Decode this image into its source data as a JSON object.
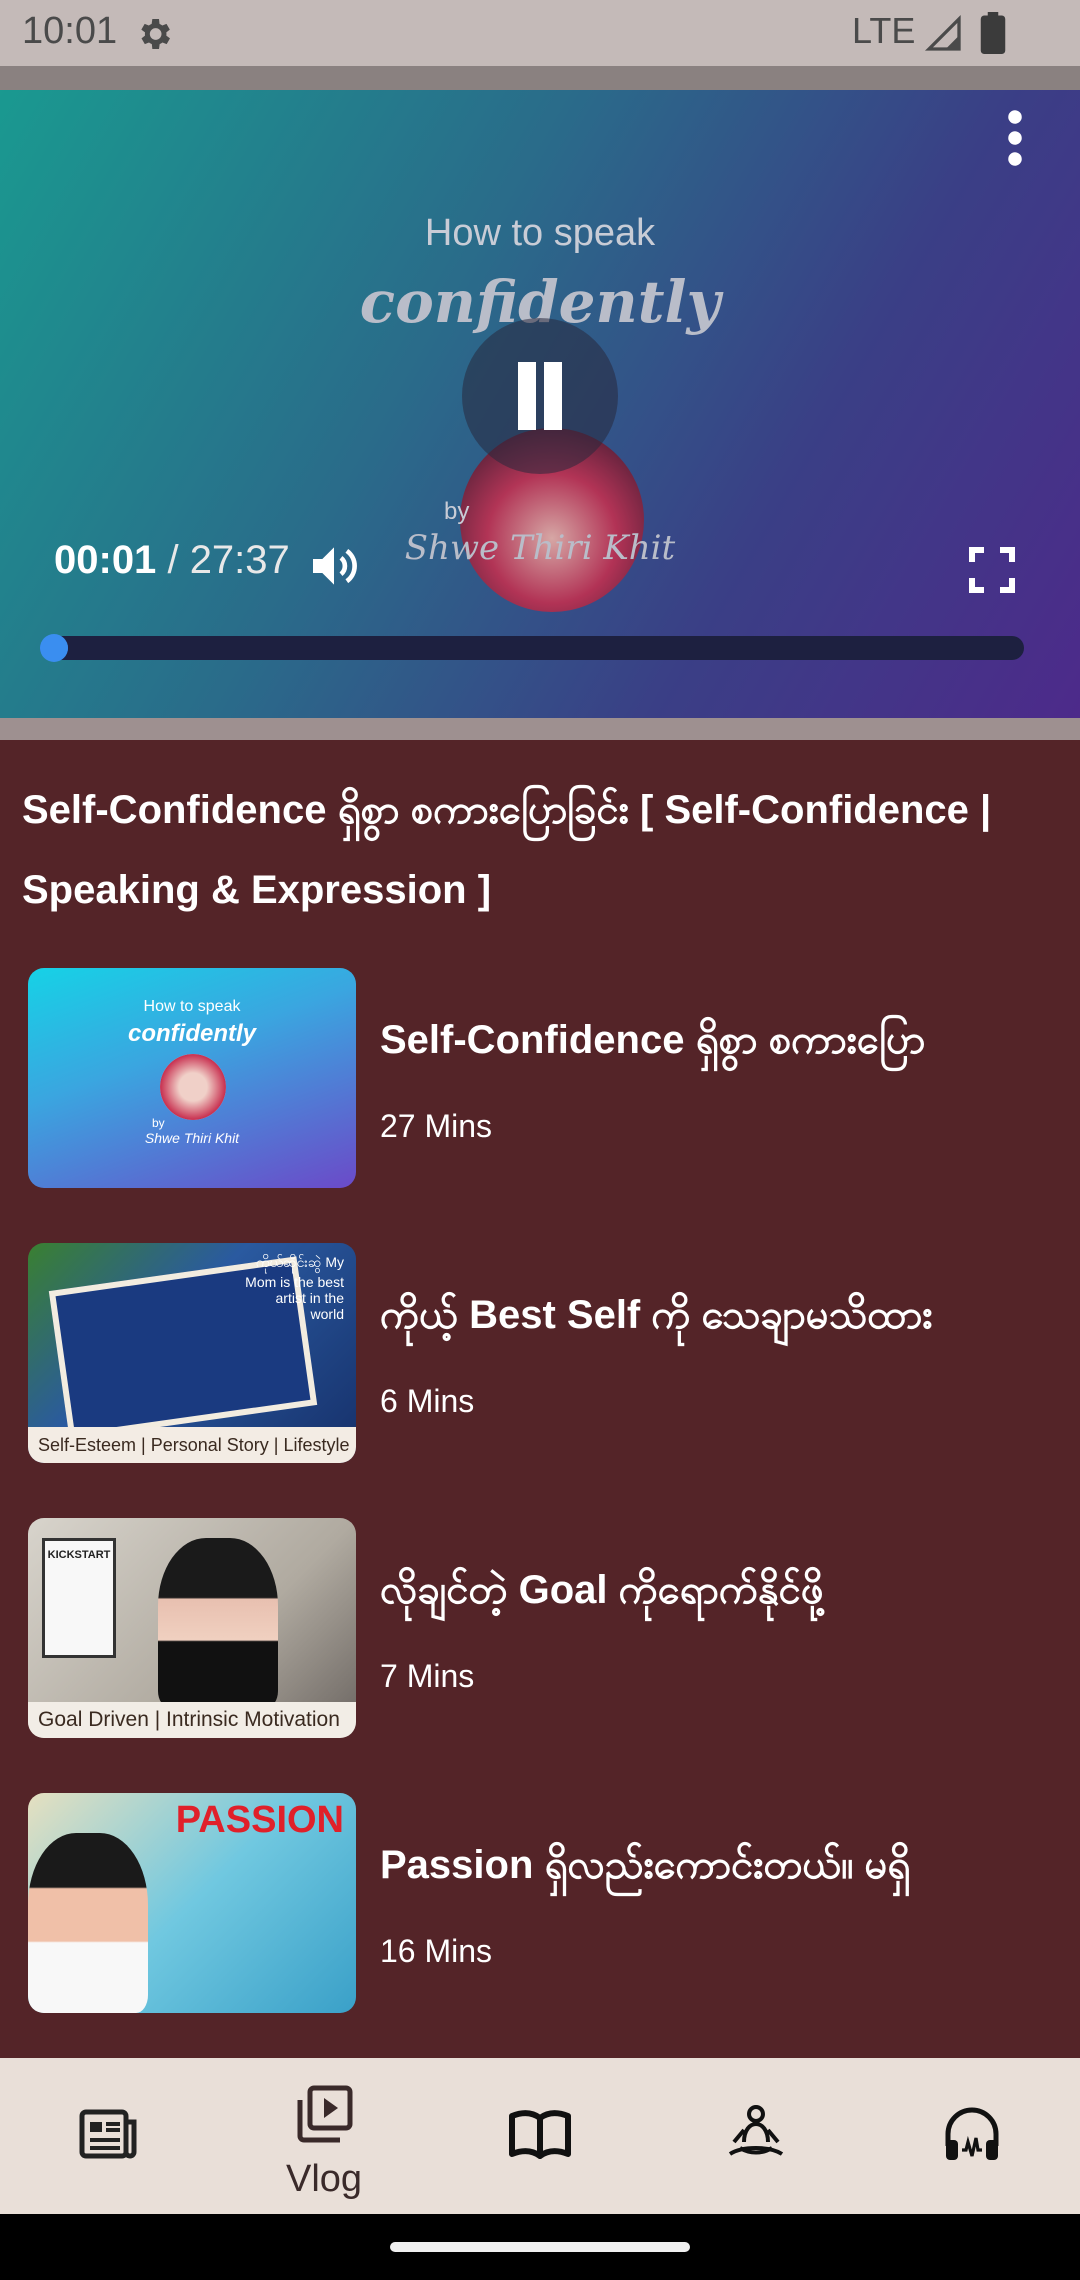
{
  "status_bar": {
    "time": "10:01",
    "network": "LTE"
  },
  "player": {
    "thumbnail": {
      "line1": "How to speak",
      "line2": "confidently",
      "by": "by",
      "author": "Shwe Thiri Khit"
    },
    "current_time": "00:01",
    "separator": "/",
    "duration": "27:37",
    "progress_fraction": 0.01
  },
  "section_title": "Self-Confidence ရှိစွာ စကားပြောခြင်း [ Self-Confidence | Speaking & Expression ]",
  "videos": [
    {
      "title": "Self-Confidence ရှိစွာ စကားပြော",
      "duration": "27 Mins",
      "thumb_line1": "How to speak",
      "thumb_line2": "confidently",
      "thumb_by": "by",
      "thumb_author": "Shwe Thiri Khit"
    },
    {
      "title": "ကိုယ့် Best Self ကို သေချာမသိထား",
      "duration": "6 Mins",
      "thumb_text": "ကိုယ်ဆိုင်းဆွဲ My Mom is the best artist in the world",
      "thumb_caption": "Self-Esteem | Personal Story | Lifestyle"
    },
    {
      "title": "လိုချင်တဲ့ Goal ကိုရောက်နိုင်ဖို့",
      "duration": "7 Mins",
      "thumb_book": "KICKSTART",
      "thumb_caption": "Goal Driven | Intrinsic Motivation"
    },
    {
      "title": "Passion ရှိလည်းကောင်းတယ်။ မရှိ",
      "duration": "16 Mins",
      "thumb_headline": "PASSION"
    }
  ],
  "bottom_nav": {
    "items": [
      {
        "icon": "news-icon",
        "label": ""
      },
      {
        "icon": "video-library-icon",
        "label": "Vlog"
      },
      {
        "icon": "book-icon",
        "label": ""
      },
      {
        "icon": "meditation-icon",
        "label": ""
      },
      {
        "icon": "headphones-icon",
        "label": ""
      }
    ],
    "active_index": 1
  },
  "colors": {
    "background": "#542428",
    "nav_background": "#e9dfd8",
    "progress_fill": "#3a6fd0"
  }
}
